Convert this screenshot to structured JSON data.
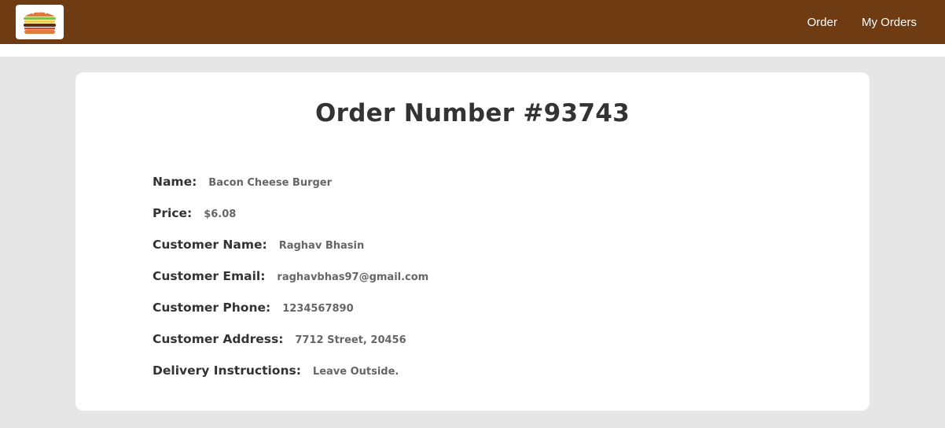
{
  "navbar": {
    "logo_icon": "burger-icon",
    "links": [
      {
        "label": "Order"
      },
      {
        "label": "My Orders"
      }
    ],
    "background_color": "#6f3b13"
  },
  "order": {
    "title": "Order Number #93743",
    "fields": [
      {
        "label": "Name:",
        "value": "Bacon Cheese Burger"
      },
      {
        "label": "Price:",
        "value": "$6.08"
      },
      {
        "label": "Customer Name:",
        "value": "Raghav Bhasin"
      },
      {
        "label": "Customer Email:",
        "value": "raghavbhas97@gmail.com"
      },
      {
        "label": "Customer Phone:",
        "value": "1234567890"
      },
      {
        "label": "Customer Address:",
        "value": "7712 Street, 20456"
      },
      {
        "label": "Delivery Instructions:",
        "value": "Leave Outside."
      }
    ]
  }
}
